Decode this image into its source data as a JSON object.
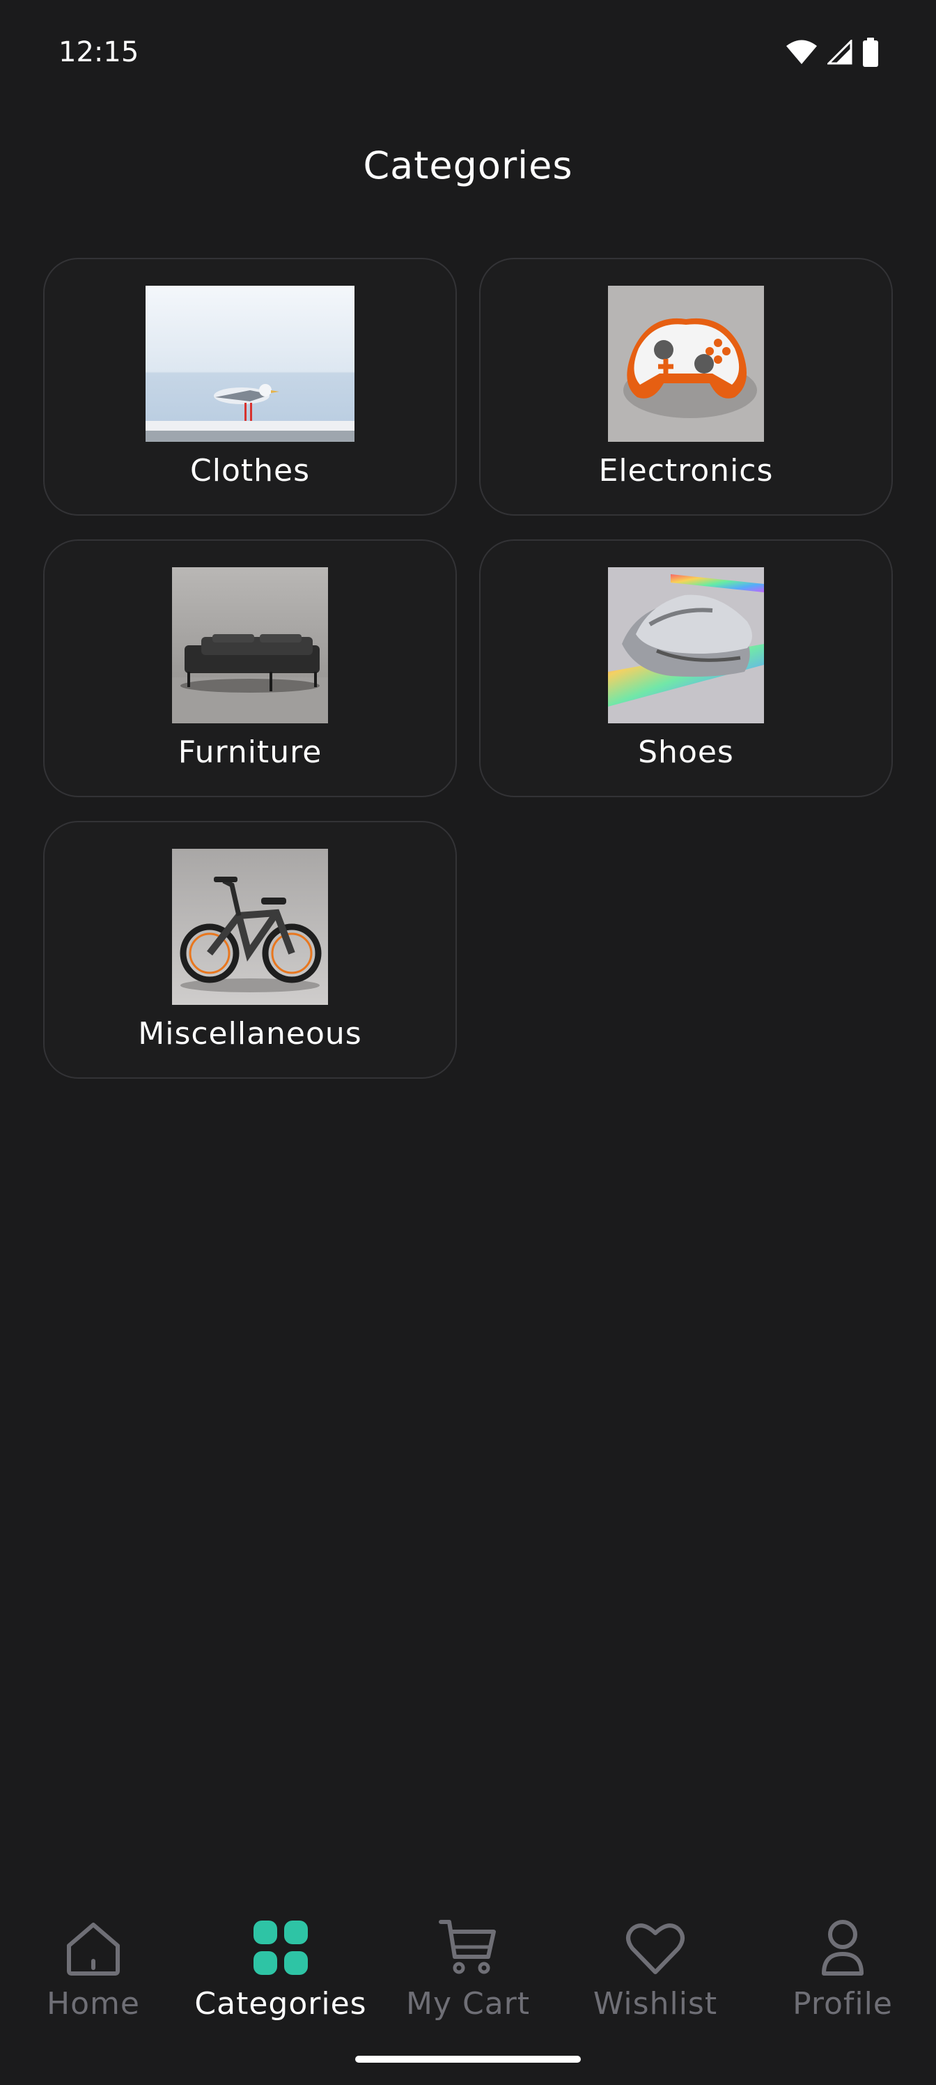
{
  "status_bar": {
    "time": "12:15"
  },
  "header": {
    "title": "Categories"
  },
  "categories": [
    {
      "label": "Clothes",
      "image": "seagull-on-railing"
    },
    {
      "label": "Electronics",
      "image": "game-controller"
    },
    {
      "label": "Furniture",
      "image": "black-sofa"
    },
    {
      "label": "Shoes",
      "image": "silver-sneakers"
    },
    {
      "label": "Miscellaneous",
      "image": "electric-bike"
    }
  ],
  "bottom_nav": {
    "items": [
      {
        "label": "Home",
        "icon": "home-icon"
      },
      {
        "label": "Categories",
        "icon": "categories-icon",
        "active": true
      },
      {
        "label": "My Cart",
        "icon": "cart-icon"
      },
      {
        "label": "Wishlist",
        "icon": "heart-icon"
      },
      {
        "label": "Profile",
        "icon": "profile-icon"
      }
    ]
  },
  "colors": {
    "background": "#1b1b1c",
    "accent": "#2ec4a5",
    "inactive": "#6f6f76",
    "card_border": "#333336"
  }
}
